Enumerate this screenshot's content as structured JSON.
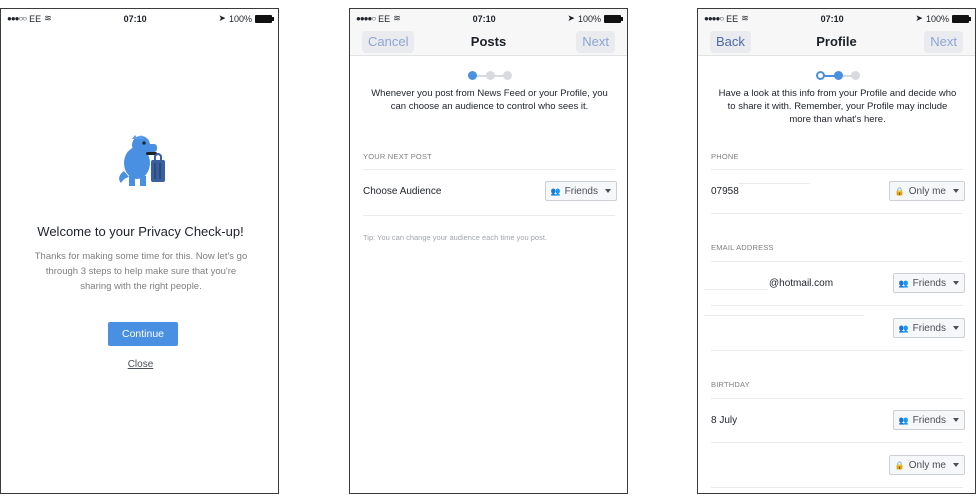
{
  "status": {
    "carrier": "EE",
    "time": "07:10",
    "battery": "100%"
  },
  "screen1": {
    "title": "Welcome to your Privacy Check-up!",
    "body": "Thanks for making some time for this. Now let's go through 3 steps to help make sure that you're sharing with the right people.",
    "continue_label": "Continue",
    "close_label": "Close"
  },
  "screen2": {
    "nav": {
      "left": "Cancel",
      "title": "Posts",
      "right": "Next"
    },
    "intro": "Whenever you post from News Feed or your Profile, you can choose an audience to control who sees it.",
    "section": "YOUR NEXT POST",
    "row_label": "Choose Audience",
    "audience": "Friends",
    "tip": "Tip: You can change your audience each time you post."
  },
  "screen3": {
    "nav": {
      "left": "Back",
      "title": "Profile",
      "right": "Next"
    },
    "intro": "Have a look at this info from your Profile and decide who to share it with. Remember, your Profile may include more than what's here.",
    "phone_label": "PHONE",
    "phone_value": "07958",
    "phone_audience": "Only me",
    "email_label": "EMAIL ADDRESS",
    "email_value": "@hotmail.com",
    "email_audience": "Friends",
    "email2_audience": "Friends",
    "birthday_label": "BIRTHDAY",
    "birthday_value": "8 July",
    "birthday_audience": "Friends",
    "birthyear_audience": "Only me"
  },
  "colors": {
    "accent": "#4a90e2",
    "nav_text": "#8ca4d6"
  }
}
